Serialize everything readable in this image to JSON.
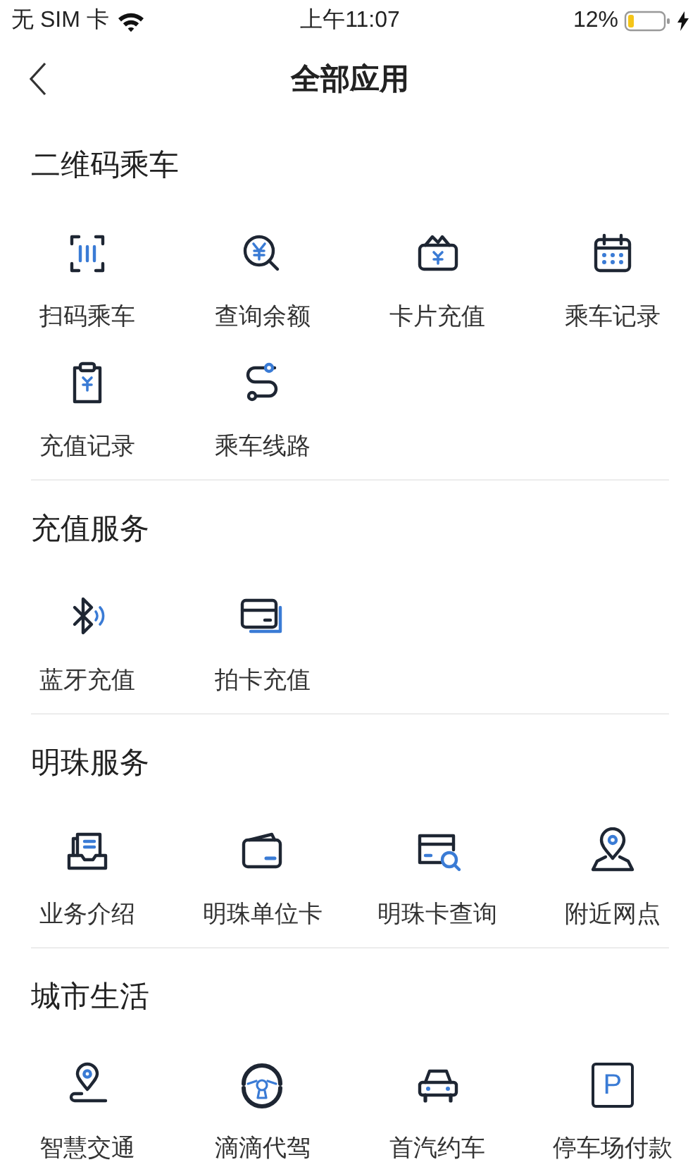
{
  "status_bar": {
    "carrier": "无 SIM 卡",
    "time": "上午11:07",
    "battery": "12%"
  },
  "nav": {
    "title": "全部应用"
  },
  "sections": [
    {
      "title": "二维码乘车",
      "items": [
        {
          "label": "扫码乘车"
        },
        {
          "label": "查询余额"
        },
        {
          "label": "卡片充值"
        },
        {
          "label": "乘车记录"
        },
        {
          "label": "充值记录"
        },
        {
          "label": "乘车线路"
        }
      ]
    },
    {
      "title": "充值服务",
      "items": [
        {
          "label": "蓝牙充值"
        },
        {
          "label": "拍卡充值"
        }
      ]
    },
    {
      "title": "明珠服务",
      "items": [
        {
          "label": "业务介绍"
        },
        {
          "label": "明珠单位卡"
        },
        {
          "label": "明珠卡查询"
        },
        {
          "label": "附近网点"
        }
      ]
    },
    {
      "title": "城市生活",
      "items": [
        {
          "label": "智慧交通"
        },
        {
          "label": "滴滴代驾"
        },
        {
          "label": "首汽约车"
        },
        {
          "label": "停车场付款",
          "icon_text": "P"
        }
      ]
    }
  ]
}
